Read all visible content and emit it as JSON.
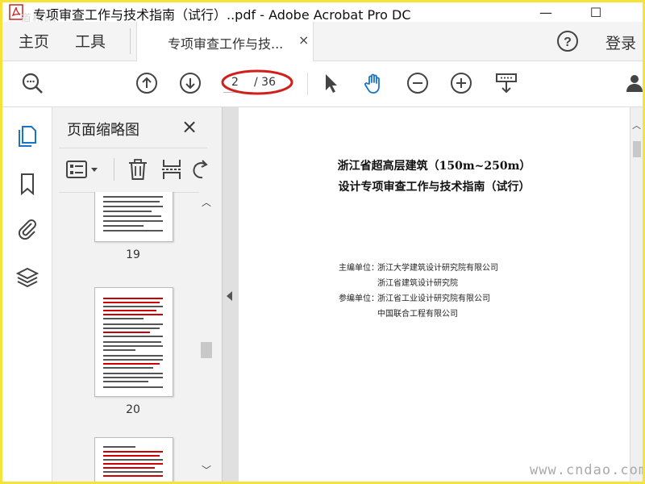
{
  "window": {
    "title": "专项审查工作与技术指南（试行）..pdf - Adobe Acrobat Pro DC",
    "minimize": "—",
    "maximize": "☐",
    "watermark": "道桥网"
  },
  "menubar": {
    "home": "主页",
    "tools": "工具",
    "doc_tab": "专项审查工作与技...",
    "doc_tab_close": "×",
    "login": "登录"
  },
  "toolbar": {
    "current_page": "2",
    "total_pages": "/ 36"
  },
  "thumbnail_panel": {
    "title": "页面缩略图",
    "close": "×",
    "pages": [
      {
        "label": "19"
      },
      {
        "label": "20"
      }
    ]
  },
  "document": {
    "title_line1": "浙江省超高层建筑（150m~250m）",
    "title_line2": "设计专项审查工作与技术指南（试行）",
    "chief_label": "主编单位：",
    "chief_org1": "浙江大学建筑设计研究院有限公司",
    "chief_org2": "浙江省建筑设计研究院",
    "co_label": "参编单位：",
    "co_org1": "浙江省工业设计研究院有限公司",
    "co_org2": "中国联合工程有限公司"
  },
  "footer": {
    "site": "www.cndao.com"
  },
  "colors": {
    "accent": "#1a73c9",
    "highlight_ellipse": "#d0201c",
    "frame_border": "#f5e33a"
  }
}
